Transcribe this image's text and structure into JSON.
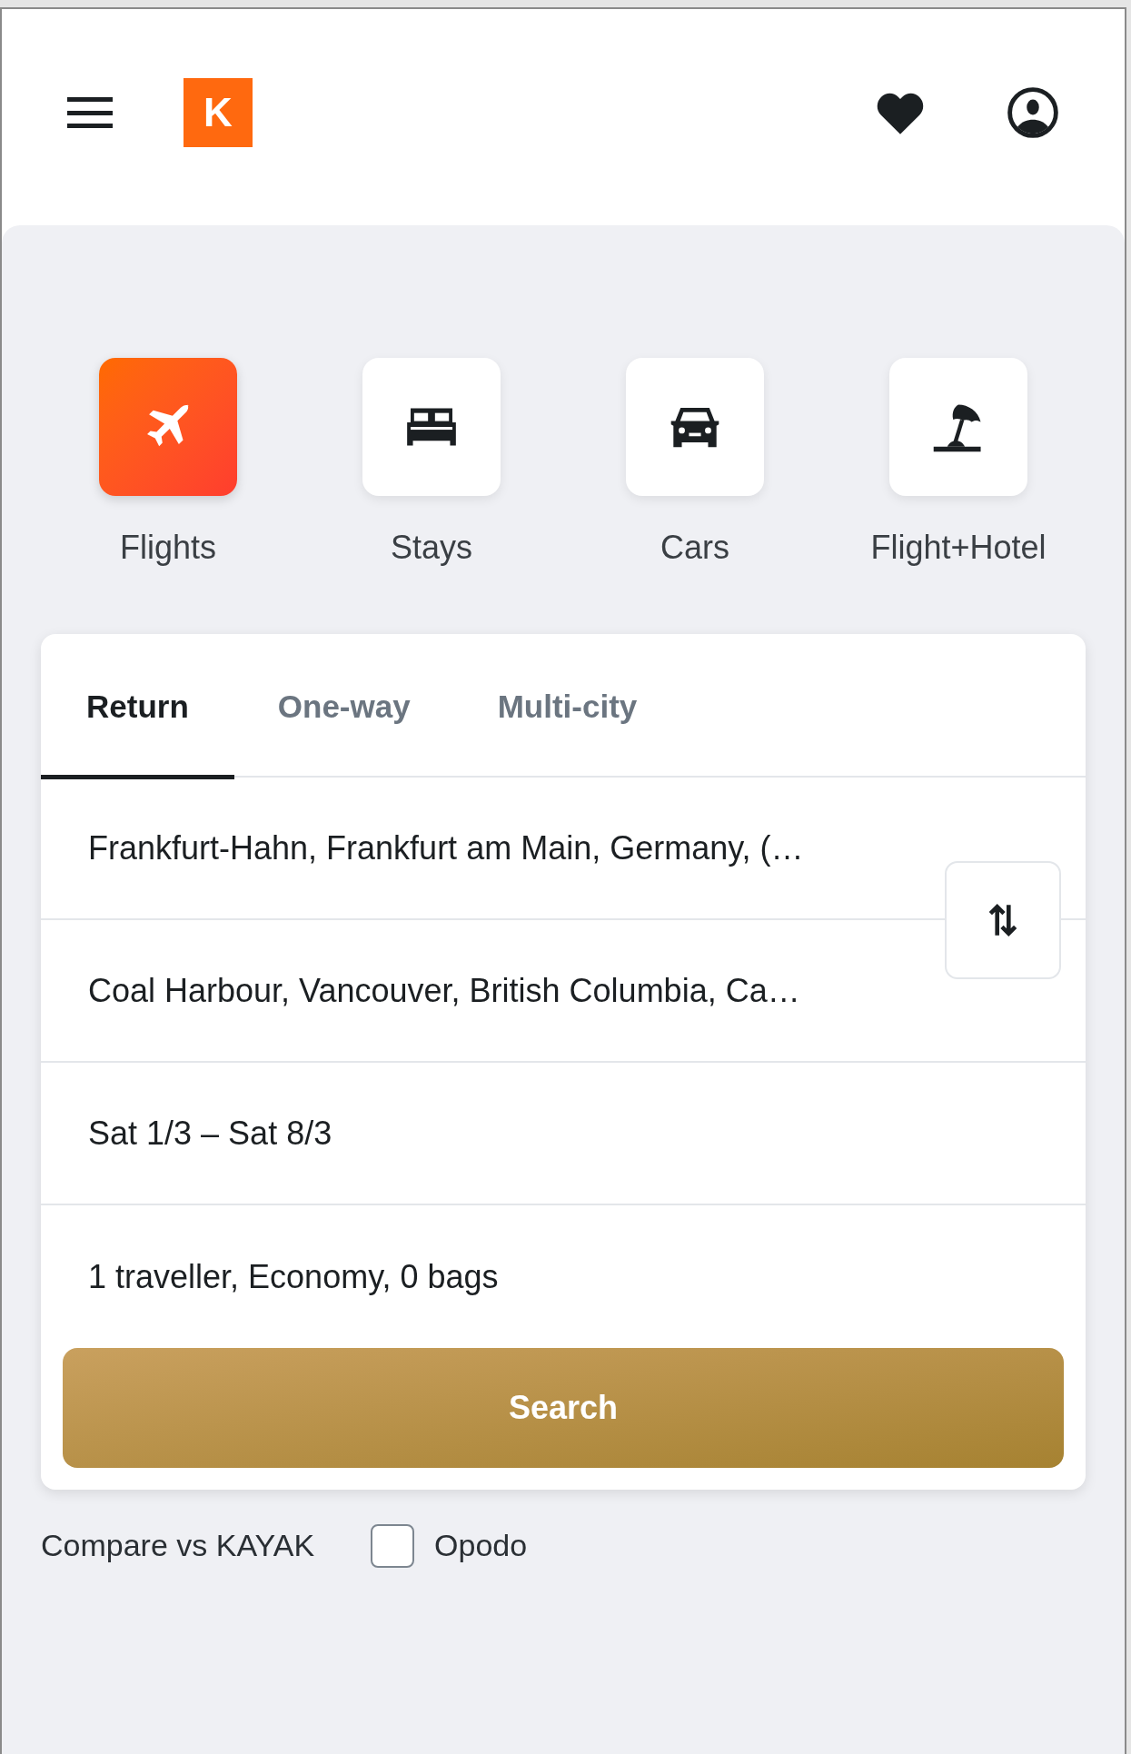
{
  "header": {
    "logo": "K"
  },
  "categories": [
    {
      "label": "Flights",
      "kind": "flights",
      "selected": true
    },
    {
      "label": "Stays",
      "kind": "stays",
      "selected": false
    },
    {
      "label": "Cars",
      "kind": "cars",
      "selected": false
    },
    {
      "label": "Flight+Hotel",
      "kind": "packages",
      "selected": false
    }
  ],
  "trip_tabs": [
    {
      "label": "Return",
      "selected": true
    },
    {
      "label": "One-way",
      "selected": false
    },
    {
      "label": "Multi-city",
      "selected": false
    }
  ],
  "fields": [
    {
      "value": "Frankfurt-Hahn, Frankfurt am Main, Germany, (…"
    },
    {
      "value": "Coal Harbour, Vancouver, British Columbia, Ca…"
    },
    {
      "value": "Sat 1/3 – Sat 8/3"
    },
    {
      "value": "1 traveller, Economy, 0 bags"
    }
  ],
  "search_button": "Search",
  "compare": {
    "label": "Compare vs KAYAK",
    "options": [
      {
        "label": "Opodo",
        "checked": false
      }
    ]
  }
}
